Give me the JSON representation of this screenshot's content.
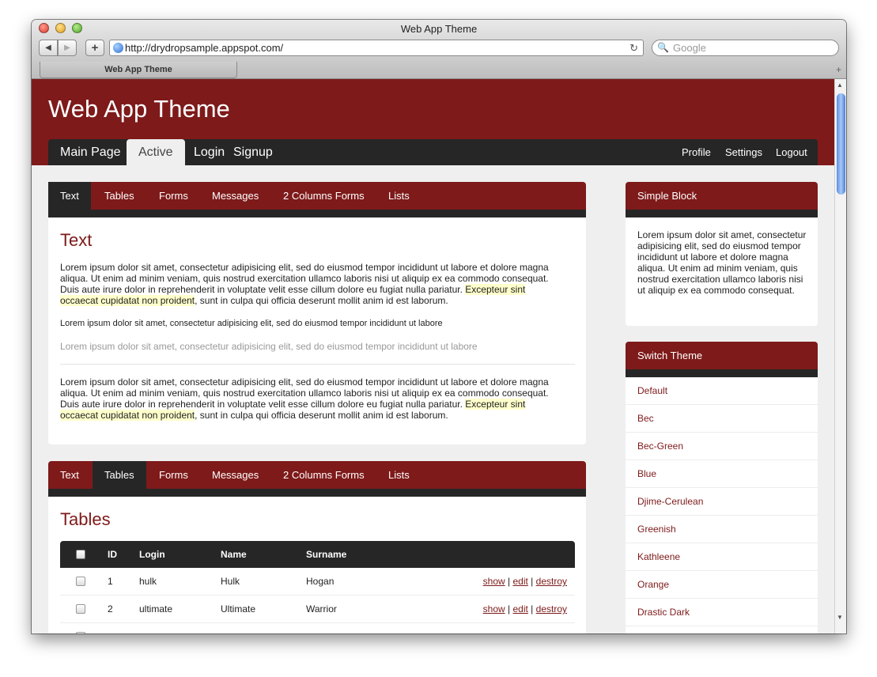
{
  "window": {
    "title": "Web App Theme"
  },
  "browser": {
    "back": "◀",
    "forward": "▶",
    "add": "+",
    "url": "http://drydropsample.appspot.com/",
    "reload": "↻",
    "search_placeholder": "Google",
    "search_icon": "🔍",
    "tab_title": "Web App Theme",
    "new_tab": "+"
  },
  "header": {
    "title": "Web App Theme",
    "nav": [
      "Main Page",
      "Active",
      "Login",
      "Signup"
    ],
    "user_nav": [
      "Profile",
      "Settings",
      "Logout"
    ]
  },
  "secondary_tabs": [
    "Text",
    "Tables",
    "Forms",
    "Messages",
    "2 Columns Forms",
    "Lists"
  ],
  "text_block": {
    "active_tab": "Text",
    "title": "Text",
    "p1_before": "Lorem ipsum dolor sit amet, consectetur adipisicing elit, sed do eiusmod tempor incididunt ut labore et dolore magna aliqua. Ut enim ad minim veniam, quis nostrud exercitation ullamco laboris nisi ut aliquip ex ea commodo consequat. Duis aute irure dolor in reprehenderit in voluptate velit esse cillum dolore eu fugiat nulla pariatur.",
    "p1_highlight": "Excepteur sint occaecat cupidatat non proident",
    "p1_after": ", sunt in culpa qui officia deserunt mollit anim id est laborum.",
    "small": "Lorem ipsum dolor sit amet, consectetur adipisicing elit, sed do eiusmod tempor incididunt ut labore",
    "gray": "Lorem ipsum dolor sit amet, consectetur adipisicing elit, sed do eiusmod tempor incididunt ut labore"
  },
  "tables_block": {
    "active_tab": "Tables",
    "title": "Tables",
    "columns": [
      "ID",
      "Login",
      "Name",
      "Surname"
    ],
    "rows": [
      {
        "id": "1",
        "login": "hulk",
        "name": "Hulk",
        "surname": "Hogan"
      },
      {
        "id": "2",
        "login": "ultimate",
        "name": "Ultimate",
        "surname": "Warrior"
      }
    ],
    "actions": [
      "show",
      "edit",
      "destroy"
    ],
    "separator": "|"
  },
  "sidebar": {
    "simple_block": {
      "title": "Simple Block",
      "text": "Lorem ipsum dolor sit amet, consectetur adipisicing elit, sed do eiusmod tempor incididunt ut labore et dolore magna aliqua. Ut enim ad minim veniam, quis nostrud exercitation ullamco laboris nisi ut aliquip ex ea commodo consequat."
    },
    "switch_theme": {
      "title": "Switch Theme",
      "items": [
        "Default",
        "Bec",
        "Bec-Green",
        "Blue",
        "Djime-Cerulean",
        "Greenish",
        "Kathleene",
        "Orange",
        "Drastic Dark"
      ]
    }
  },
  "colors": {
    "brand": "#7e1a1a",
    "dark": "#262626",
    "highlight": "#ffffcc"
  }
}
